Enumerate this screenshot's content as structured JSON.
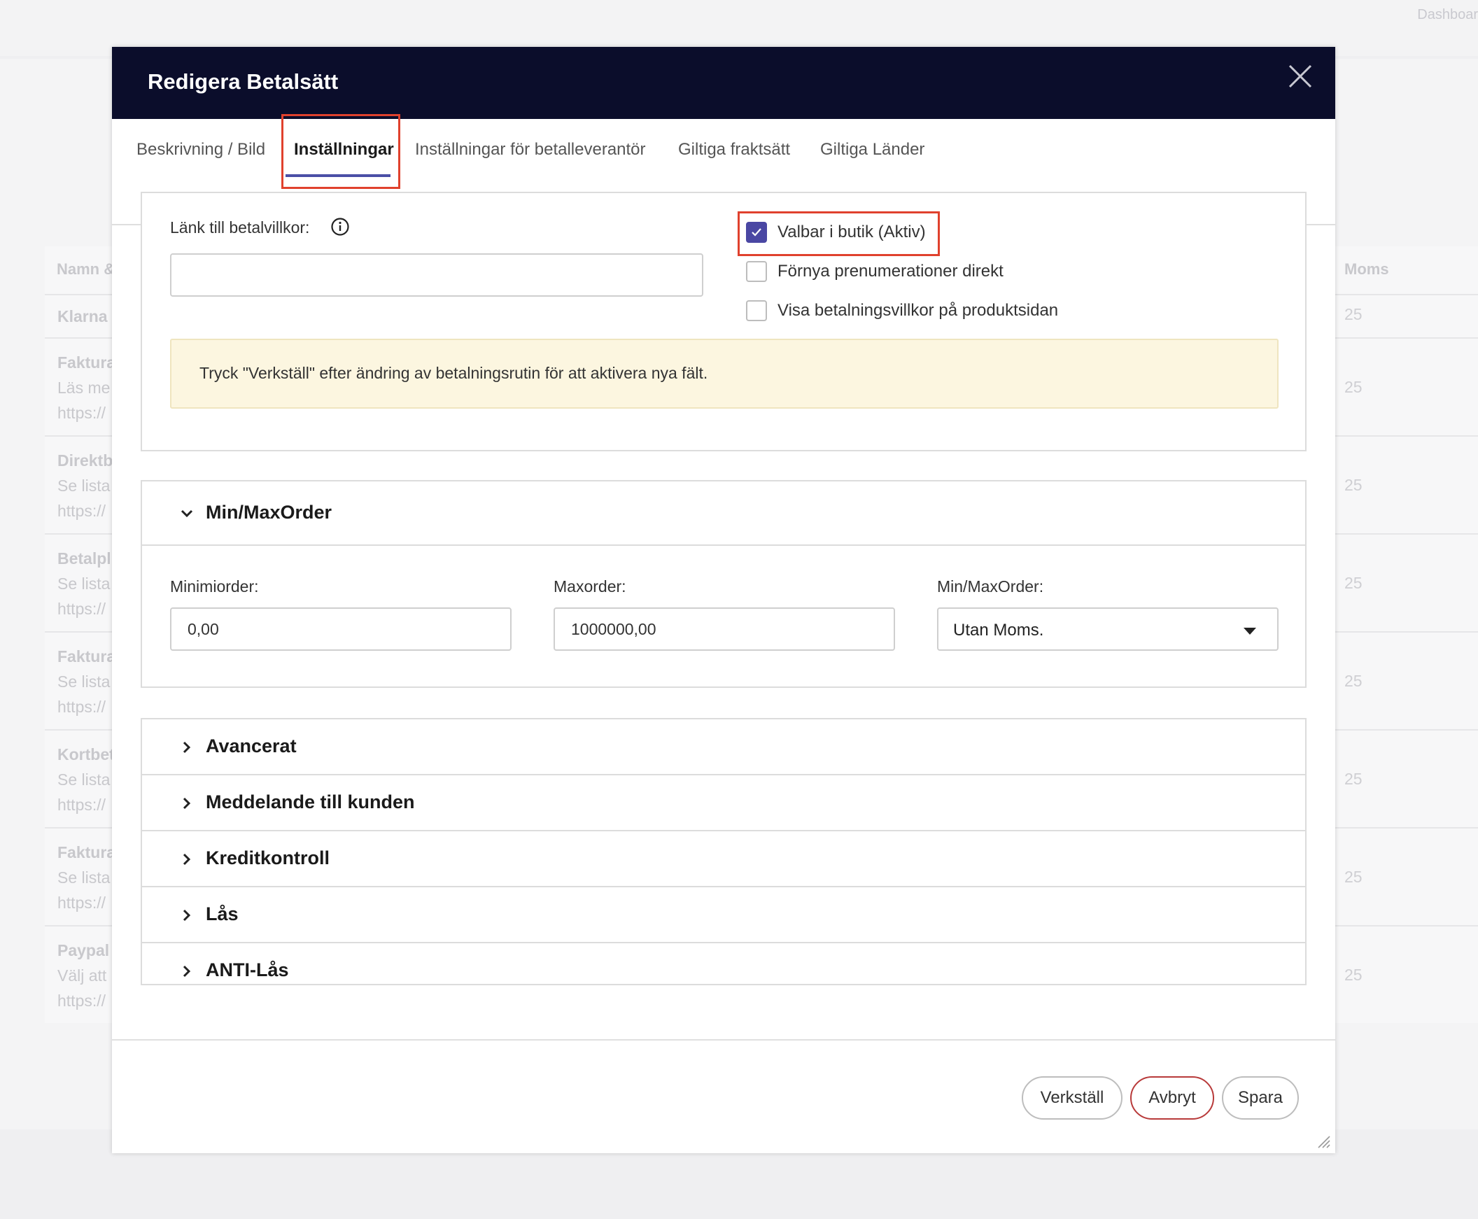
{
  "background": {
    "dashboard_label": "Dashboar",
    "col_name": "Namn &",
    "col_moms": "Moms",
    "rows": [
      {
        "name": "Klarna",
        "desc": "",
        "url": "",
        "moms": "25"
      },
      {
        "name": "Faktura",
        "desc": "Läs me",
        "url": "https://",
        "moms": "25"
      },
      {
        "name": "Direktb",
        "desc": "Se lista",
        "url": "https://",
        "moms": "25"
      },
      {
        "name": "Betalpl",
        "desc": "Se lista",
        "url": "https://",
        "moms": "25"
      },
      {
        "name": "Faktura",
        "desc": "Se lista",
        "url": "https://",
        "moms": "25"
      },
      {
        "name": "Kortbet",
        "desc": "Se lista",
        "url": "https://",
        "moms": "25"
      },
      {
        "name": "Faktura",
        "desc": "Se lista",
        "url": "https://",
        "moms": "25"
      },
      {
        "name": "Paypal",
        "desc": "Välj att",
        "url": "https://",
        "moms": "25"
      }
    ]
  },
  "dialog": {
    "title": "Redigera Betalsätt",
    "tabs": [
      {
        "label": "Beskrivning / Bild"
      },
      {
        "label": "Inställningar"
      },
      {
        "label": "Inställningar för betalleverantör"
      },
      {
        "label": "Giltiga fraktsätt"
      },
      {
        "label": "Giltiga Länder"
      }
    ],
    "active_tab": "Inställningar",
    "terms_link": {
      "label": "Länk till betalvillkor:",
      "value": ""
    },
    "checkboxes": [
      {
        "label": "Valbar i butik (Aktiv)",
        "checked": true
      },
      {
        "label": "Förnya prenumerationer direkt",
        "checked": false
      },
      {
        "label": "Visa betalningsvillkor på produktsidan",
        "checked": false
      }
    ],
    "notice": "Tryck \"Verkställ\" efter ändring av betalningsrutin för att aktivera nya fält.",
    "minmax": {
      "title": "Min/MaxOrder",
      "min_label": "Minimiorder:",
      "min_value": "0,00",
      "max_label": "Maxorder:",
      "max_value": "1000000,00",
      "mode_label": "Min/MaxOrder:",
      "mode_value": "Utan Moms."
    },
    "sections": [
      {
        "title": "Avancerat"
      },
      {
        "title": "Meddelande till kunden"
      },
      {
        "title": "Kreditkontroll"
      },
      {
        "title": "Lås"
      },
      {
        "title": "ANTI-Lås"
      }
    ],
    "buttons": {
      "apply": "Verkställ",
      "cancel": "Avbryt",
      "save": "Spara"
    },
    "colors": {
      "header_bg": "#0b0d2b",
      "accent": "#4a47a3",
      "highlight": "#e0412d",
      "notice_bg": "#fcf6e0"
    }
  }
}
